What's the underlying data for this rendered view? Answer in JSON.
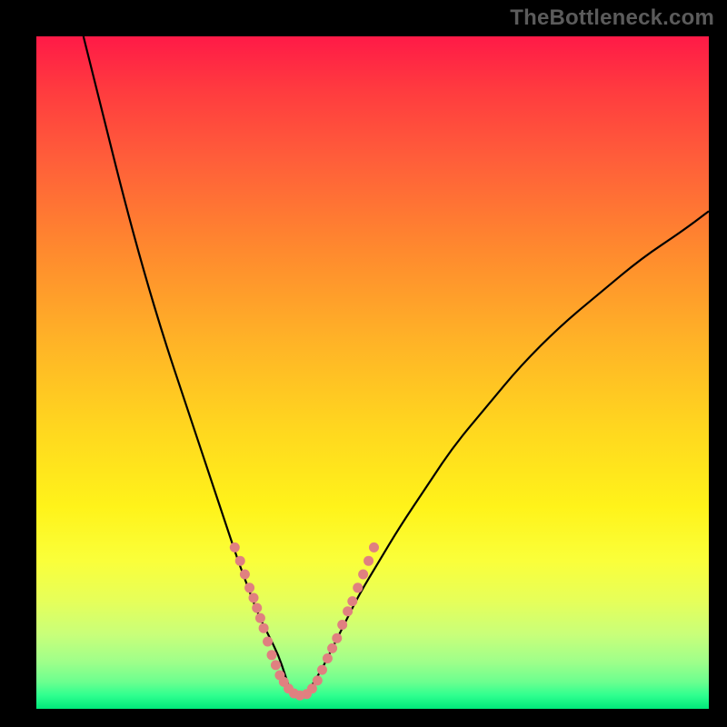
{
  "watermark": "TheBottleneck.com",
  "colors": {
    "frame": "#000000",
    "gradient_top": "#ff1a47",
    "gradient_mid": "#ffd61f",
    "gradient_bottom": "#00e87a",
    "curve": "#000000",
    "dots": "#e08080"
  },
  "chart_data": {
    "type": "line",
    "title": "",
    "xlabel": "",
    "ylabel": "",
    "xlim": [
      0,
      100
    ],
    "ylim": [
      0,
      100
    ],
    "grid": false,
    "legend": false,
    "series": [
      {
        "name": "left-branch",
        "x": [
          7,
          10,
          13,
          16,
          19,
          22,
          24,
          26,
          28,
          30,
          31.5,
          33,
          34.5,
          36,
          37,
          38
        ],
        "values": [
          100,
          88,
          76,
          65,
          55,
          46,
          40,
          34,
          28,
          22,
          18,
          14,
          11,
          8,
          5,
          2
        ]
      },
      {
        "name": "right-branch",
        "x": [
          40,
          42,
          44,
          46,
          48,
          51,
          54,
          58,
          62,
          67,
          72,
          78,
          84,
          90,
          96,
          100
        ],
        "values": [
          2,
          5,
          9,
          13,
          17,
          22,
          27,
          33,
          39,
          45,
          51,
          57,
          62,
          67,
          71,
          74
        ]
      }
    ],
    "highlight_dots": {
      "name": "bottom-cluster",
      "points": [
        {
          "x": 29.5,
          "y": 24
        },
        {
          "x": 30.3,
          "y": 22
        },
        {
          "x": 31.0,
          "y": 20
        },
        {
          "x": 31.7,
          "y": 18
        },
        {
          "x": 32.3,
          "y": 16.5
        },
        {
          "x": 32.8,
          "y": 15
        },
        {
          "x": 33.3,
          "y": 13.5
        },
        {
          "x": 33.8,
          "y": 12
        },
        {
          "x": 34.4,
          "y": 10
        },
        {
          "x": 35.0,
          "y": 8
        },
        {
          "x": 35.6,
          "y": 6.5
        },
        {
          "x": 36.2,
          "y": 5
        },
        {
          "x": 36.8,
          "y": 4
        },
        {
          "x": 37.5,
          "y": 3
        },
        {
          "x": 38.3,
          "y": 2.3
        },
        {
          "x": 39.2,
          "y": 2.0
        },
        {
          "x": 40.2,
          "y": 2.2
        },
        {
          "x": 41.0,
          "y": 3.0
        },
        {
          "x": 41.8,
          "y": 4.2
        },
        {
          "x": 42.5,
          "y": 5.8
        },
        {
          "x": 43.3,
          "y": 7.5
        },
        {
          "x": 44.0,
          "y": 9
        },
        {
          "x": 44.7,
          "y": 10.5
        },
        {
          "x": 45.5,
          "y": 12.5
        },
        {
          "x": 46.3,
          "y": 14.5
        },
        {
          "x": 47.0,
          "y": 16
        },
        {
          "x": 47.8,
          "y": 18
        },
        {
          "x": 48.6,
          "y": 20
        },
        {
          "x": 49.4,
          "y": 22
        },
        {
          "x": 50.2,
          "y": 24
        }
      ]
    }
  }
}
